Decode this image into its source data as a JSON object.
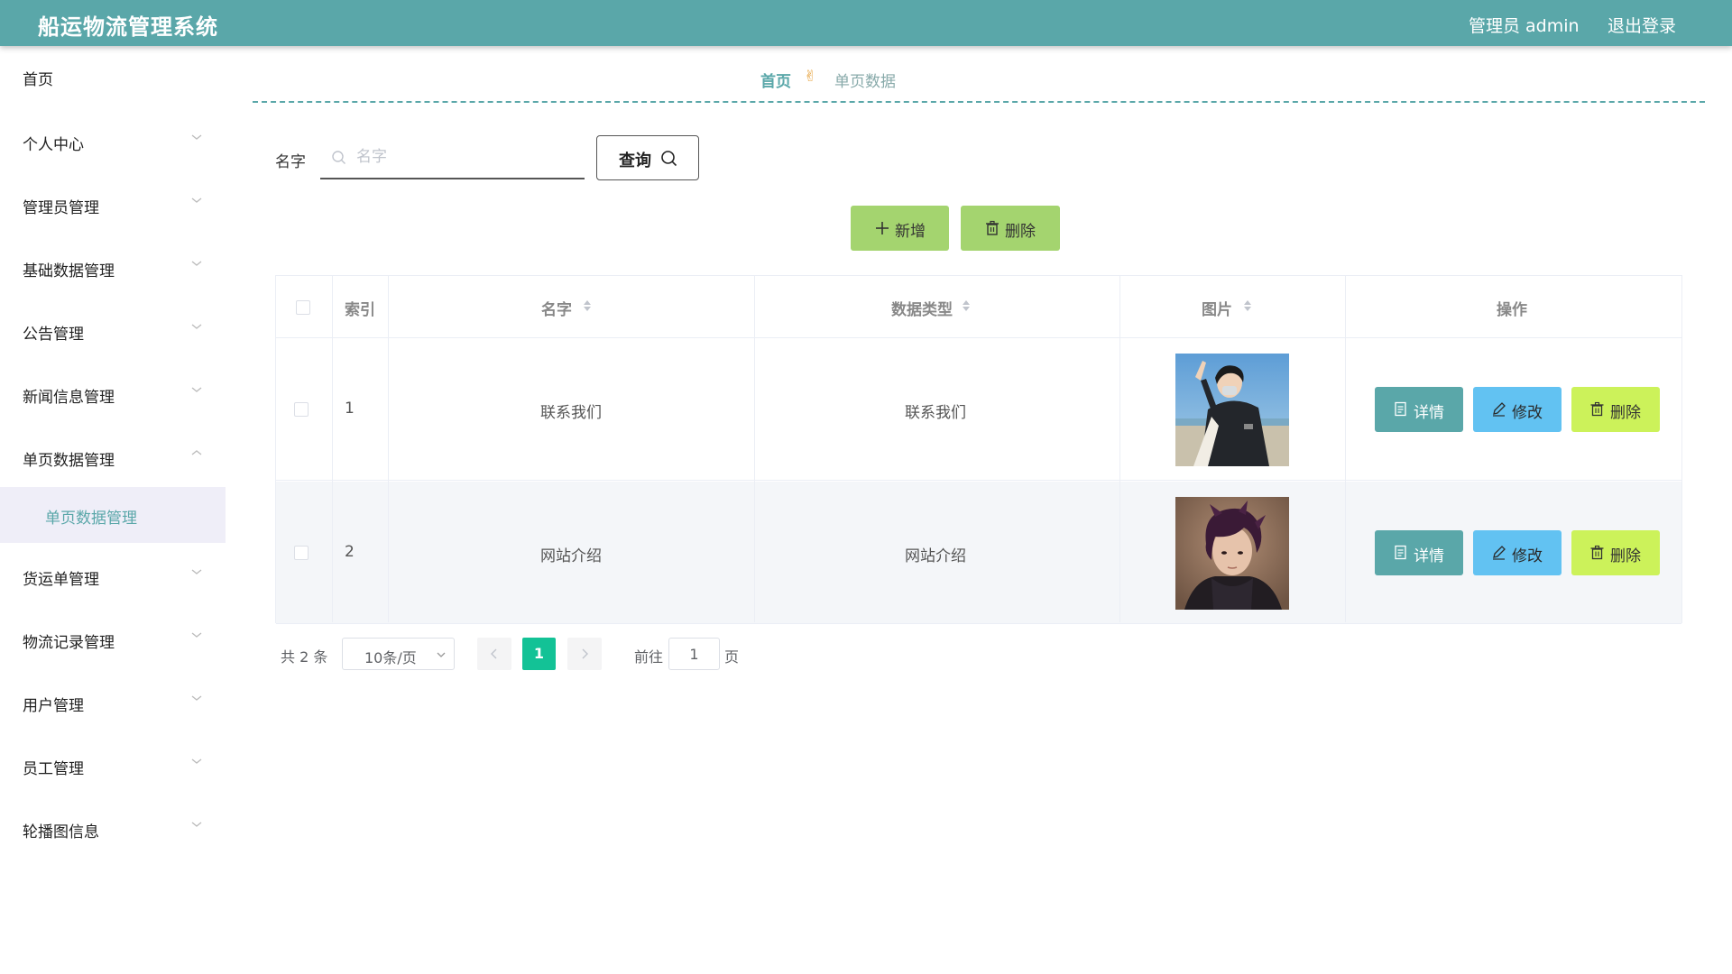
{
  "header": {
    "title": "船运物流管理系统",
    "admin_label": "管理员 admin",
    "logout": "退出登录",
    "color": "#5aa7a9"
  },
  "sidebar": {
    "items": [
      {
        "label": "首页",
        "has_chevron": false
      },
      {
        "label": "个人中心",
        "has_chevron": true,
        "chevron": "down"
      },
      {
        "label": "管理员管理",
        "has_chevron": true,
        "chevron": "down"
      },
      {
        "label": "基础数据管理",
        "has_chevron": true,
        "chevron": "down"
      },
      {
        "label": "公告管理",
        "has_chevron": true,
        "chevron": "down"
      },
      {
        "label": "新闻信息管理",
        "has_chevron": true,
        "chevron": "down"
      },
      {
        "label": "单页数据管理",
        "has_chevron": true,
        "chevron": "up",
        "expanded": true
      },
      {
        "label": "货运单管理",
        "has_chevron": true,
        "chevron": "down"
      },
      {
        "label": "物流记录管理",
        "has_chevron": true,
        "chevron": "down"
      },
      {
        "label": "用户管理",
        "has_chevron": true,
        "chevron": "down"
      },
      {
        "label": "员工管理",
        "has_chevron": true,
        "chevron": "down"
      },
      {
        "label": "轮播图信息",
        "has_chevron": true,
        "chevron": "down"
      }
    ],
    "active_subitem": "单页数据管理"
  },
  "breadcrumb": {
    "home": "首页",
    "separator_icon": "hand-icon",
    "current": "单页数据"
  },
  "search": {
    "label": "名字",
    "placeholder": "名字",
    "value": "",
    "button_label": "查询"
  },
  "actions": {
    "add_label": "新增",
    "delete_label": "删除",
    "color": "#a4d46f"
  },
  "table": {
    "columns": [
      "索引",
      "名字",
      "数据类型",
      "图片",
      "操作"
    ],
    "rows": [
      {
        "index": "1",
        "name": "联系我们",
        "type": "联系我们",
        "image": "photo-man-jacket-beach"
      },
      {
        "index": "2",
        "name": "网站介绍",
        "type": "网站介绍",
        "image": "photo-man-purple-hair"
      }
    ],
    "row_buttons": {
      "detail": "详情",
      "edit": "修改",
      "delete": "删除"
    },
    "button_colors": {
      "detail": "#5aa7a9",
      "edit": "#62c2f2",
      "delete": "#ccf25a"
    }
  },
  "pagination": {
    "total": "共 2 条",
    "page_size": "10条/页",
    "current_page": "1",
    "goto_label": "前往",
    "goto_value": "1",
    "page_suffix": "页",
    "active_color": "#13c296"
  }
}
